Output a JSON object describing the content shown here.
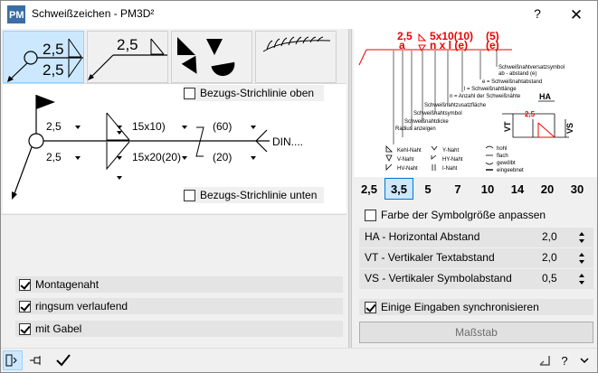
{
  "window": {
    "title": "Schweißzeichen  -  PM3D²",
    "help_glyph": "?",
    "close_glyph": "✕"
  },
  "tabs": [
    {
      "name": "tab-symbol-double",
      "selected": true,
      "label_top": "2,5",
      "label_bottom": "2,5"
    },
    {
      "name": "tab-symbol-single",
      "selected": false,
      "label_top": "2,5"
    },
    {
      "name": "tab-symbol-filled",
      "selected": false
    },
    {
      "name": "tab-symbol-din",
      "selected": false
    }
  ],
  "weld_panel": {
    "ref_line_top_label": "Bezugs-Strichlinie oben",
    "ref_line_top_checked": false,
    "ref_line_bottom_label": "Bezugs-Strichlinie unten",
    "ref_line_bottom_checked": false,
    "top_row": {
      "size": "2,5",
      "length": "15x10)",
      "pitch": "(60)"
    },
    "bottom_row": {
      "size": "2,5",
      "length": "15x20(20)",
      "pitch": "(20)"
    },
    "din_text": "DIN...."
  },
  "options": {
    "montage": {
      "label": "Montagenaht",
      "checked": true
    },
    "ringsum": {
      "label": "ringsum verlaufend",
      "checked": true
    },
    "gabel": {
      "label": "mit Gabel",
      "checked": true
    }
  },
  "diagram": {
    "red_a": "a",
    "red_seam": "2,5",
    "red_formula": "5x10(10)",
    "red_pitch": "(5)",
    "red_n": "n x l (e)",
    "red_e": "(e)",
    "red_a2": "2,5",
    "labels": [
      "Schweißnahtversatzsymbol",
      "ab - abstand (e)",
      "e = Schweißnahtabstand",
      "l = Schweißnahtlänge",
      "n = Anzahl der Schweißnähte",
      "Schweißnahtzusatzfläche",
      "Schweißnahtsymbol",
      "Schweißnahtdicke",
      "Radius anzeigen"
    ],
    "legend_left": [
      "Kehl-Naht",
      "V-Naht",
      "HV-Naht"
    ],
    "legend_mid": [
      "Y-Naht",
      "HY-Naht",
      "I-Naht"
    ],
    "legend_right": [
      "hohl",
      "flach",
      "gewölbt",
      "eingeebnet"
    ],
    "dim_ha": "HA",
    "dim_vt": "VT",
    "dim_vs": "VS"
  },
  "sizes": [
    "2,5",
    "3,5",
    "5",
    "7",
    "10",
    "14",
    "20",
    "30"
  ],
  "selected_size": "3,5",
  "farbe": {
    "label": "Farbe der Symbolgröße anpassen",
    "checked": false
  },
  "params": [
    {
      "name": "ha",
      "label": "HA - Horizontal Abstand",
      "value": "2,0"
    },
    {
      "name": "vt",
      "label": "VT - Vertikaler Textabstand",
      "value": "2,0"
    },
    {
      "name": "vs",
      "label": "VS - Vertikaler Symbolabstand",
      "value": "0,5"
    }
  ],
  "sync": {
    "label": "Einige Eingaben synchronisieren",
    "checked": true
  },
  "massstab_label": "Maßstab",
  "statusbar": {
    "help_glyph": "?"
  }
}
